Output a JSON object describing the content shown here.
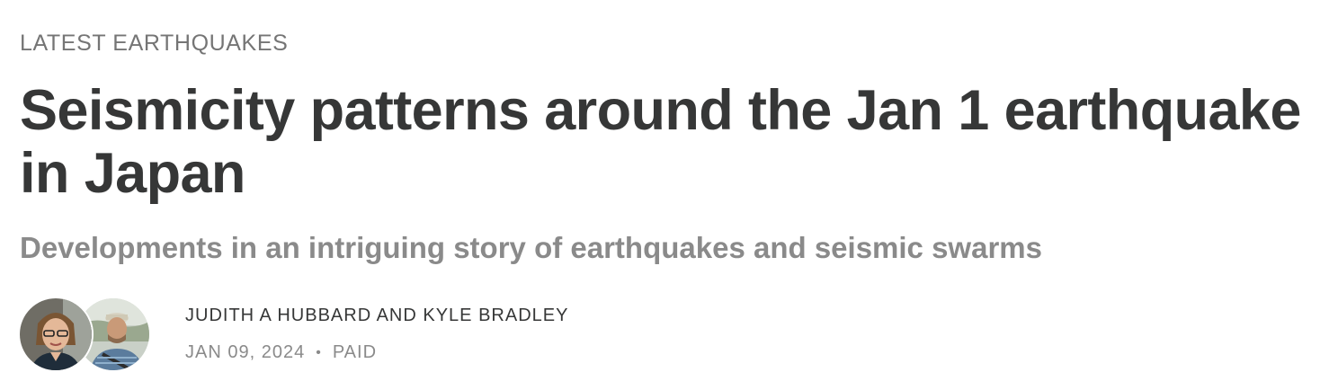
{
  "section": {
    "label": "LATEST EARTHQUAKES"
  },
  "post": {
    "title": "Seismicity patterns around the Jan 1 earthquake in Japan",
    "subtitle": "Developments in an intriguing story of earthquakes and seismic swarms"
  },
  "byline": {
    "authors": "JUDITH A HUBBARD AND KYLE BRADLEY",
    "date": "JAN 09, 2024",
    "separator": "•",
    "audience": "PAID",
    "avatars": [
      {
        "icon": "author-avatar-photo"
      },
      {
        "icon": "author-avatar-photo"
      }
    ]
  },
  "colors": {
    "text": "#363737",
    "muted": "#757575",
    "subtitle": "#8a8a8a"
  }
}
